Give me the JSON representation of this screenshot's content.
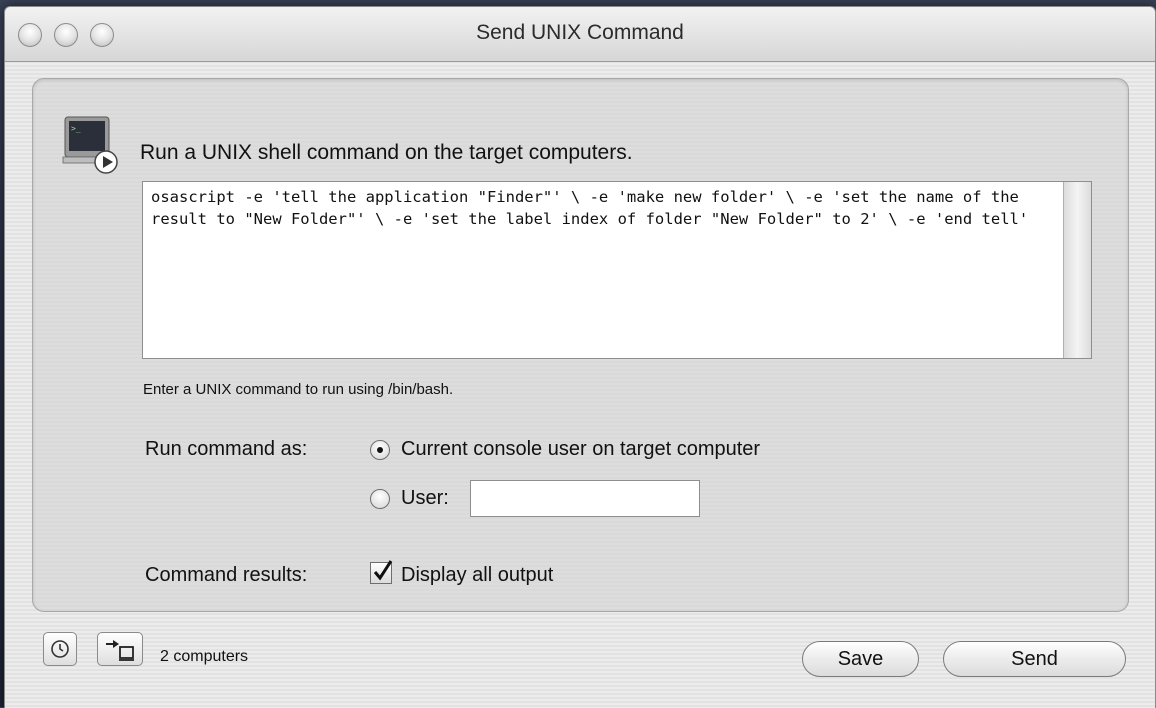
{
  "window": {
    "title": "Send UNIX Command"
  },
  "heading": "Run a UNIX shell command on the target computers.",
  "command": {
    "text": "osascript -e 'tell the application \"Finder\"' \\ -e 'make new folder' \\ -e 'set the name of the result to \"New Folder\"' \\ -e 'set the label index of folder \"New Folder\" to 2' \\ -e 'end tell'"
  },
  "hint": "Enter a UNIX command to run using /bin/bash.",
  "run_as": {
    "label": "Run command as:",
    "option_console": "Current console user on target computer",
    "option_user": "User:",
    "selected": "console",
    "user_value": ""
  },
  "results": {
    "label": "Command results:",
    "option": "Display all output",
    "checked": true
  },
  "footer": {
    "computers": "2 computers",
    "save_label": "Save",
    "send_label": "Send"
  },
  "icons": {
    "task": "clock-icon",
    "target": "target-computers-icon",
    "terminal": "terminal-icon"
  }
}
